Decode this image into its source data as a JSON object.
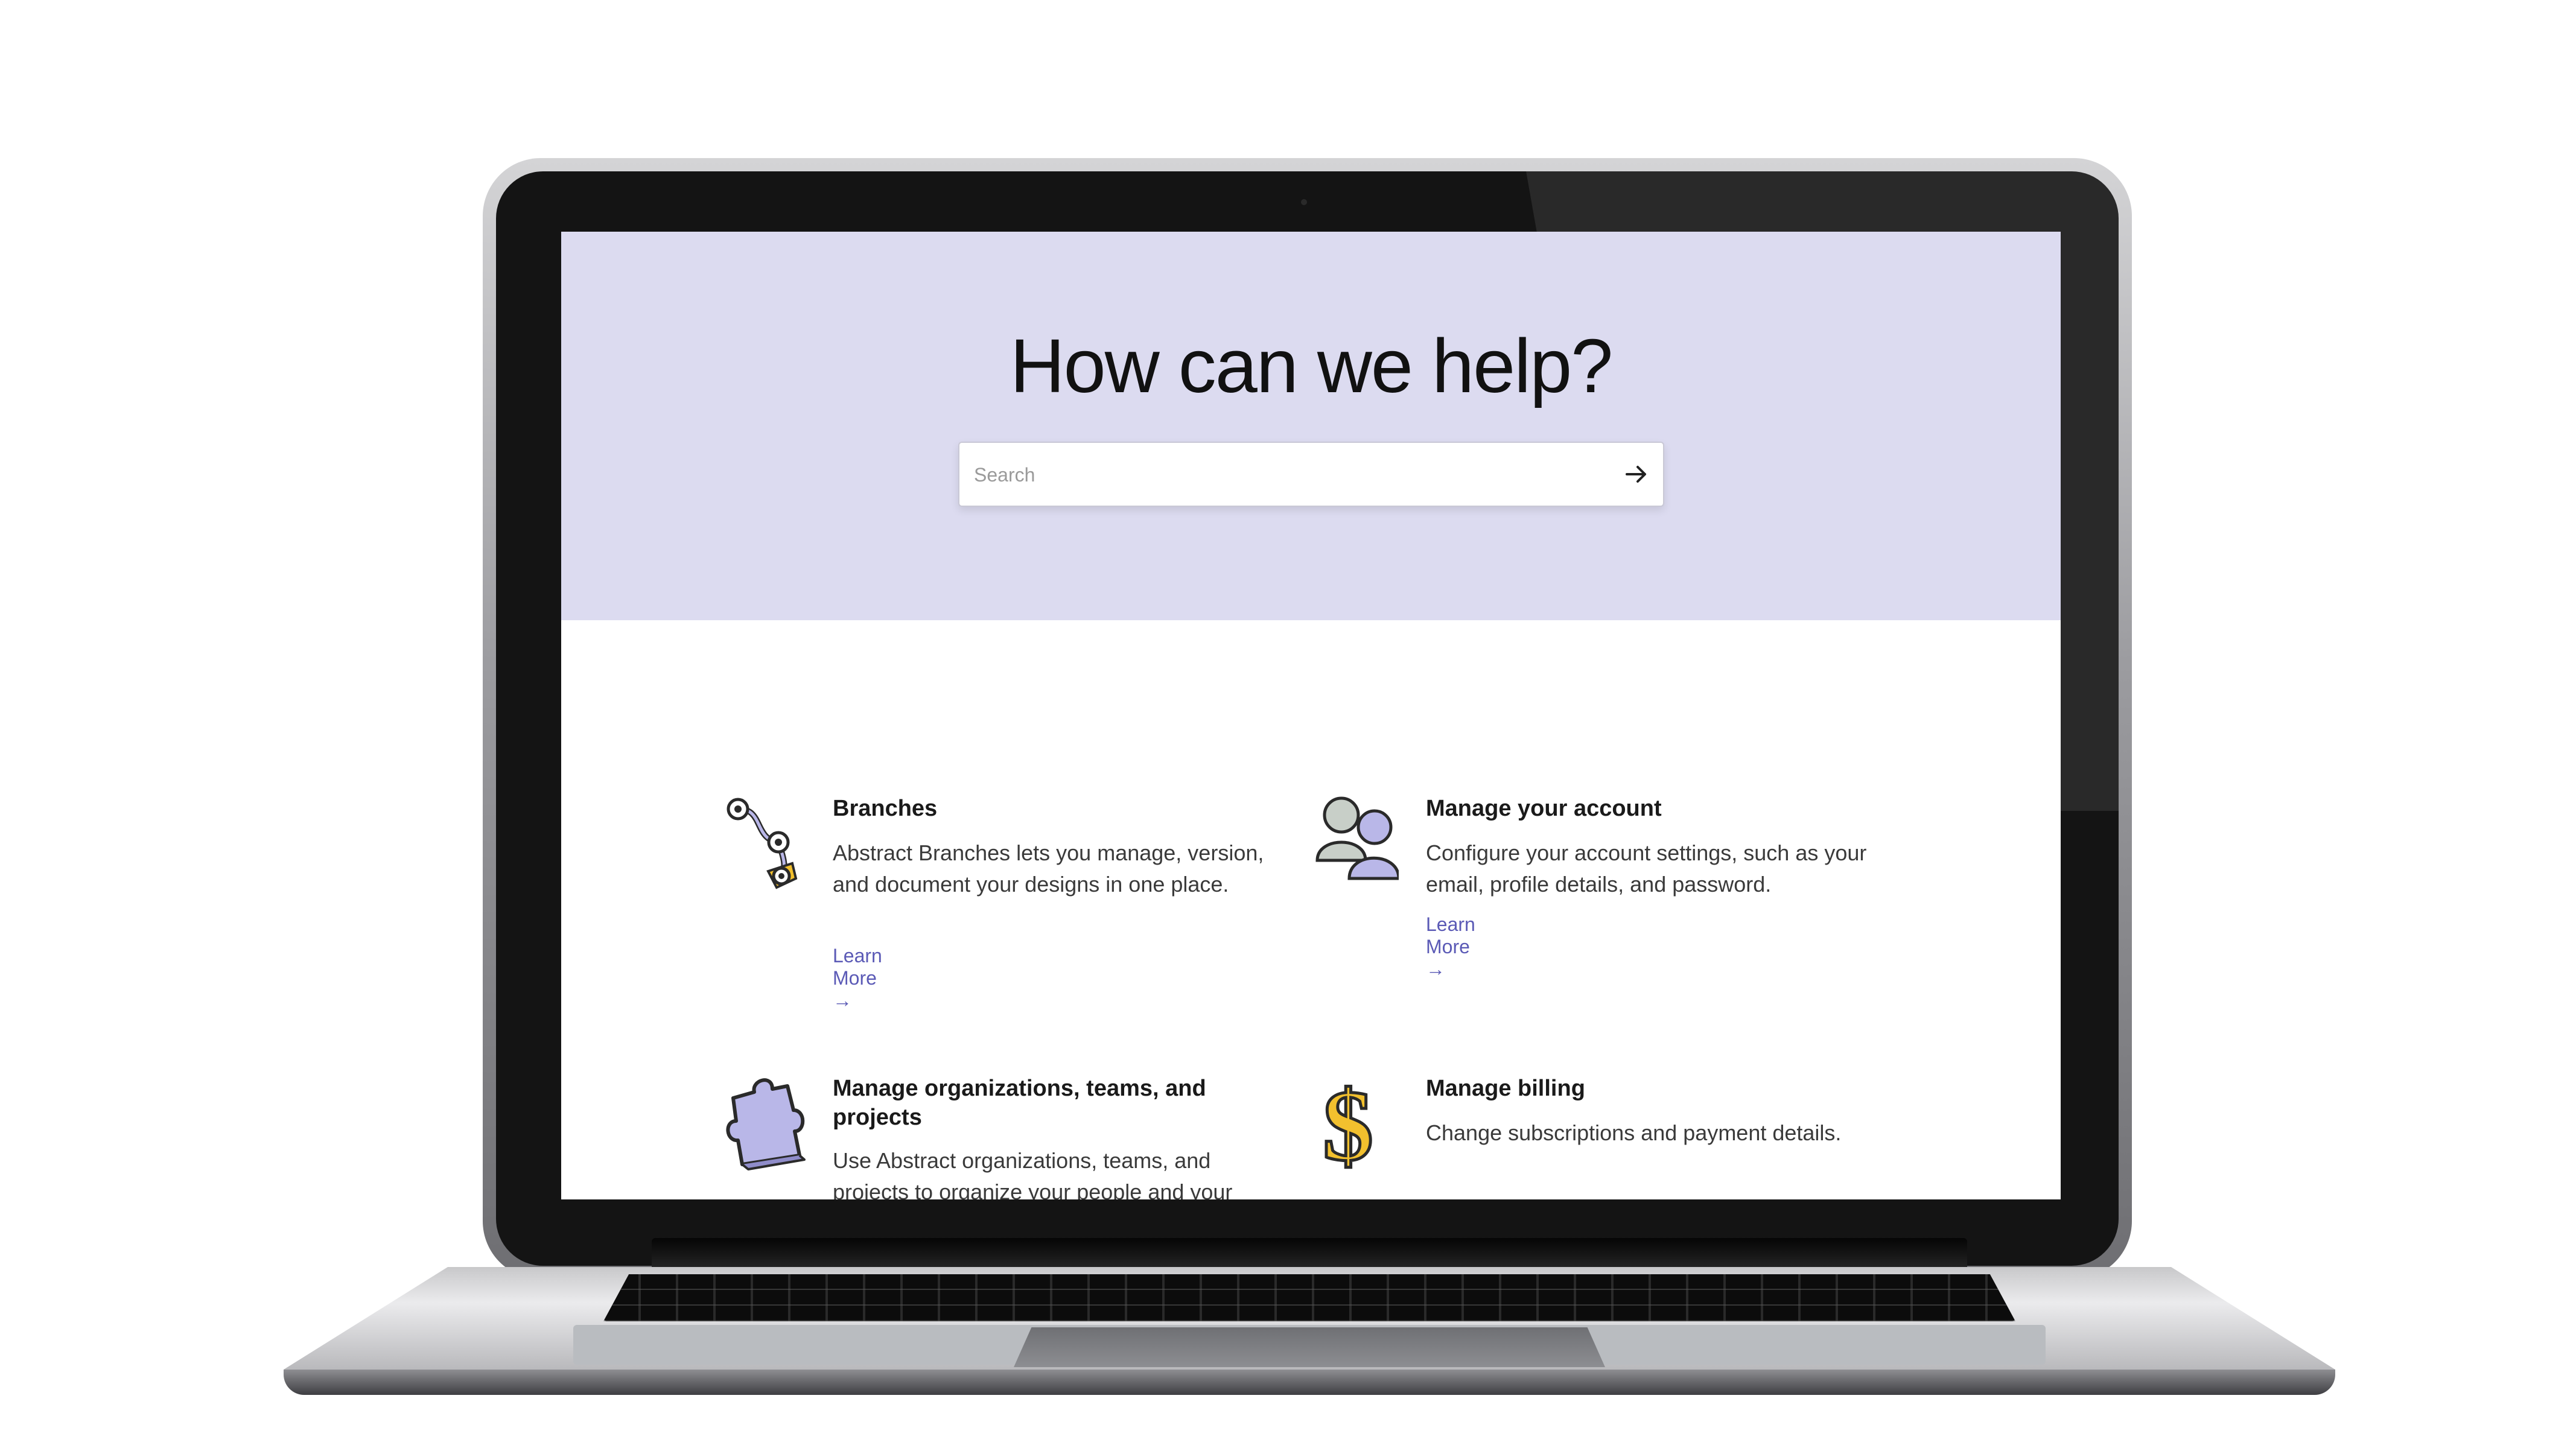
{
  "hero": {
    "title": "How can we help?",
    "search_placeholder": "Search",
    "search_icon": "arrow-right-icon"
  },
  "cards": [
    {
      "title": "Branches",
      "description": "Abstract Branches lets you manage, version, and document your designs in one place.",
      "link": "Learn More →",
      "icon": "branches-icon"
    },
    {
      "title": "Manage your account",
      "description": "Configure your account settings, such as your email, profile details, and password.",
      "link": "Learn More →",
      "icon": "users-icon"
    },
    {
      "title": "Manage organizations, teams, and projects",
      "description": "Use Abstract organizations, teams, and projects to organize your people and your",
      "icon": "puzzle-piece-icon"
    },
    {
      "title": "Manage billing",
      "description": "Change subscriptions and payment details.",
      "icon": "dollar-sign-icon"
    }
  ],
  "colors": {
    "hero_bg": "#dcdbf0",
    "link": "#5b5ab6",
    "icon_yellow": "#f2c02e",
    "icon_lavender": "#b9b7e8"
  }
}
